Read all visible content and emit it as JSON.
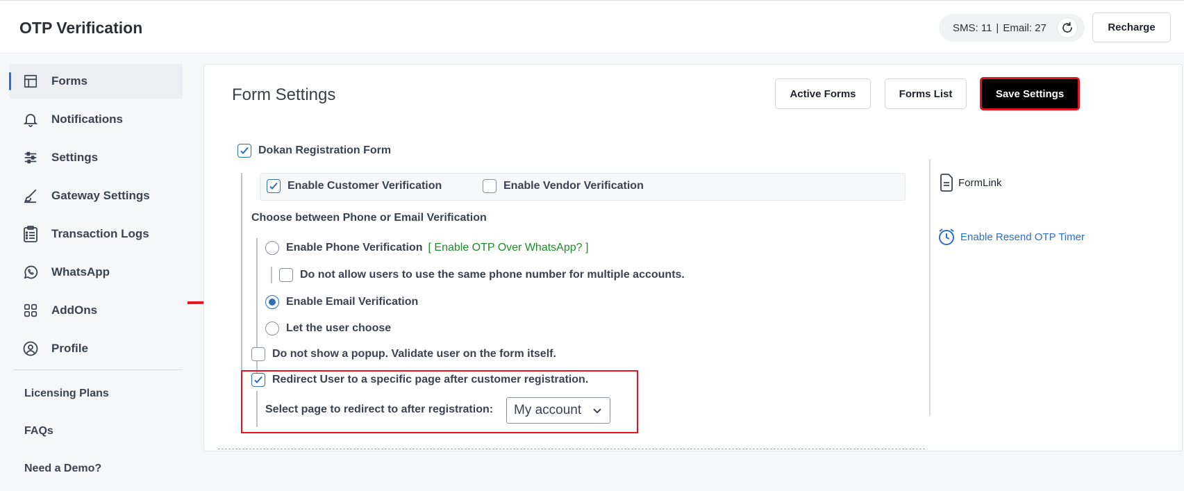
{
  "header": {
    "app_title": "OTP Verification",
    "balance": {
      "sms_label": "SMS: 11",
      "separator": "|",
      "email_label": "Email: 27"
    },
    "refresh_icon": "refresh-icon",
    "recharge_label": "Recharge"
  },
  "sidebar": {
    "items": [
      {
        "label": "Forms",
        "icon": "table-layout-icon",
        "active": true
      },
      {
        "label": "Notifications",
        "icon": "bell-icon"
      },
      {
        "label": "Settings",
        "icon": "sliders-icon"
      },
      {
        "label": "Gateway Settings",
        "icon": "brush-icon"
      },
      {
        "label": "Transaction Logs",
        "icon": "clipboard-list-icon"
      },
      {
        "label": "WhatsApp",
        "icon": "whatsapp-icon"
      },
      {
        "label": "AddOns",
        "icon": "grid-icon"
      },
      {
        "label": "Profile",
        "icon": "user-circle-icon"
      }
    ],
    "links": [
      "Licensing Plans",
      "FAQs",
      "Need a Demo?"
    ]
  },
  "main": {
    "title": "Form Settings",
    "buttons": {
      "active_forms": "Active Forms",
      "forms_list": "Forms List",
      "save_settings": "Save Settings"
    },
    "form_name": "Dokan Registration Form",
    "form_checked": true,
    "enable_customer_verification": "Enable Customer Verification",
    "enable_vendor_verification": "Enable Vendor Verification",
    "choose_heading": "Choose between Phone or Email Verification",
    "phone_option": "Enable Phone Verification",
    "whatsapp_link": "[ Enable OTP Over WhatsApp? ]",
    "same_phone_option": "Do not allow users to use the same phone number for multiple accounts.",
    "email_option": "Enable Email Verification",
    "user_choose_option": "Let the user choose",
    "no_popup_option": "Do not show a popup. Validate user on the form itself.",
    "redirect_option": "Redirect User to a specific page after customer registration.",
    "redirect_select_label": "Select page to redirect to after registration:",
    "redirect_select_value": "My account",
    "selected_verification": "email"
  },
  "side_panel": {
    "formlink_label": "FormLink",
    "resend_timer_label": "Enable Resend OTP Timer"
  },
  "colors": {
    "accent": "#2f6fb8",
    "highlight": "#e0141e",
    "link_green": "#1f8a2e",
    "link_blue": "#2c6ecb"
  }
}
